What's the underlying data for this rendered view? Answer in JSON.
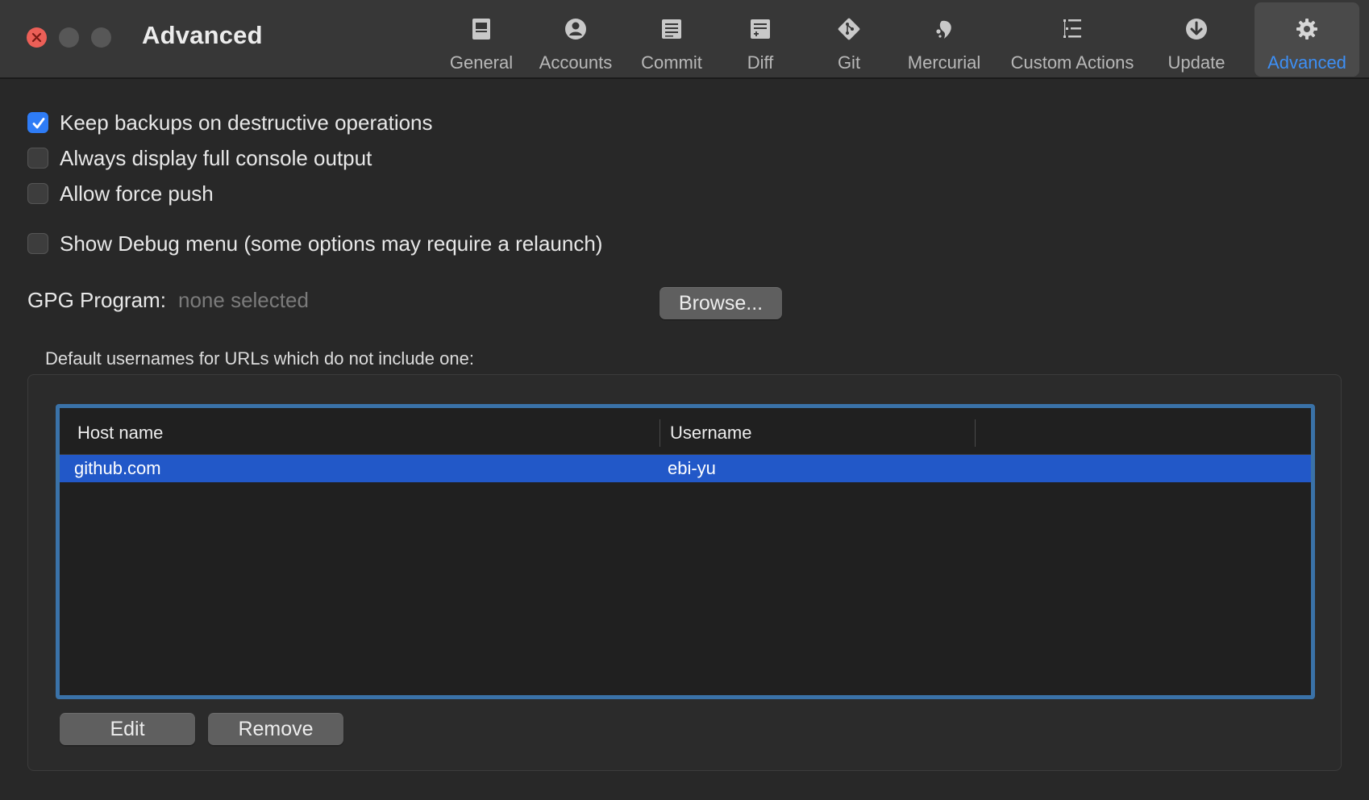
{
  "window": {
    "title": "Advanced"
  },
  "toolbar": {
    "tabs": [
      {
        "label": "General",
        "icon": "general-icon"
      },
      {
        "label": "Accounts",
        "icon": "accounts-icon"
      },
      {
        "label": "Commit",
        "icon": "commit-icon"
      },
      {
        "label": "Diff",
        "icon": "diff-icon"
      },
      {
        "label": "Git",
        "icon": "git-icon"
      },
      {
        "label": "Mercurial",
        "icon": "mercurial-icon"
      },
      {
        "label": "Custom Actions",
        "icon": "custom-actions-icon"
      },
      {
        "label": "Update",
        "icon": "update-icon"
      },
      {
        "label": "Advanced",
        "icon": "gear-icon"
      }
    ],
    "active_tab": "Advanced"
  },
  "options": {
    "keep_backups": {
      "label": "Keep backups on destructive operations",
      "checked": true
    },
    "full_console": {
      "label": "Always display full console output",
      "checked": false
    },
    "force_push": {
      "label": "Allow force push",
      "checked": false
    },
    "debug_menu": {
      "label": "Show Debug menu (some options may require a relaunch)",
      "checked": false
    }
  },
  "gpg": {
    "label": "GPG Program:",
    "value": "none selected",
    "browse_label": "Browse..."
  },
  "usernames": {
    "caption": "Default usernames for URLs which do not include one:",
    "columns": [
      "Host name",
      "Username"
    ],
    "rows": [
      {
        "host": "github.com",
        "username": "ebi-yu",
        "selected": true
      }
    ],
    "edit_label": "Edit",
    "remove_label": "Remove"
  },
  "colors": {
    "accent": "#3d8ff5",
    "selection": "#2258c8",
    "close_button": "#ec5f57"
  }
}
